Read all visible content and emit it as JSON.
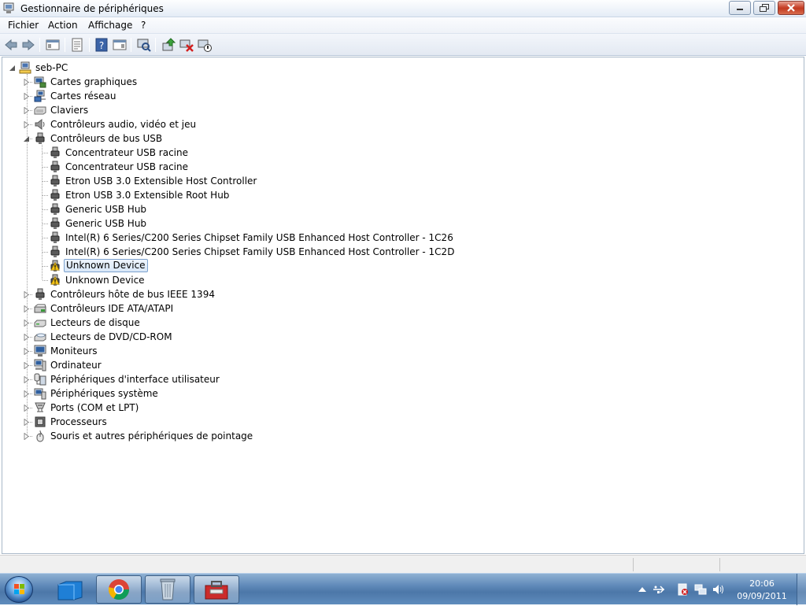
{
  "window": {
    "title": "Gestionnaire de périphériques"
  },
  "menu": {
    "items": [
      "Fichier",
      "Action",
      "Affichage",
      "?"
    ]
  },
  "toolbar": {
    "icons": [
      "back-arrow-icon",
      "forward-arrow-icon",
      "show-hide-console-tree-icon",
      "properties-icon",
      "help-icon",
      "show-action-pane-icon",
      "scan-hardware-icon",
      "update-driver-icon",
      "uninstall-icon",
      "disable-device-icon"
    ]
  },
  "tree": {
    "root": "seb-PC",
    "categories": [
      {
        "label": "Cartes graphiques",
        "icon": "display-adapter-icon",
        "expanded": false
      },
      {
        "label": "Cartes réseau",
        "icon": "network-adapter-icon",
        "expanded": false
      },
      {
        "label": "Claviers",
        "icon": "keyboard-icon",
        "expanded": false
      },
      {
        "label": "Contrôleurs audio, vidéo et jeu",
        "icon": "speaker-icon",
        "expanded": false
      },
      {
        "label": "Contrôleurs de bus USB",
        "icon": "usb-plug-icon",
        "expanded": true,
        "children": [
          {
            "label": "Concentrateur USB racine",
            "icon": "usb-plug-icon",
            "warning": false
          },
          {
            "label": "Concentrateur USB racine",
            "icon": "usb-plug-icon",
            "warning": false
          },
          {
            "label": "Etron USB 3.0 Extensible Host Controller",
            "icon": "usb-plug-icon",
            "warning": false
          },
          {
            "label": "Etron USB 3.0 Extensible Root Hub",
            "icon": "usb-plug-icon",
            "warning": false
          },
          {
            "label": "Generic USB Hub",
            "icon": "usb-plug-icon",
            "warning": false
          },
          {
            "label": "Generic USB Hub",
            "icon": "usb-plug-icon",
            "warning": false
          },
          {
            "label": "Intel(R) 6 Series/C200 Series Chipset Family USB Enhanced Host Controller - 1C26",
            "icon": "usb-plug-icon",
            "warning": false
          },
          {
            "label": "Intel(R) 6 Series/C200 Series Chipset Family USB Enhanced Host Controller - 1C2D",
            "icon": "usb-plug-icon",
            "warning": false
          },
          {
            "label": "Unknown Device",
            "icon": "usb-plug-icon",
            "warning": true,
            "selected": true
          },
          {
            "label": "Unknown Device",
            "icon": "usb-plug-icon",
            "warning": true
          }
        ]
      },
      {
        "label": "Contrôleurs hôte de bus IEEE 1394",
        "icon": "usb-plug-icon",
        "expanded": false
      },
      {
        "label": "Contrôleurs IDE ATA/ATAPI",
        "icon": "ide-controller-icon",
        "expanded": false
      },
      {
        "label": "Lecteurs de disque",
        "icon": "disk-drive-icon",
        "expanded": false
      },
      {
        "label": "Lecteurs de DVD/CD-ROM",
        "icon": "dvd-drive-icon",
        "expanded": false
      },
      {
        "label": "Moniteurs",
        "icon": "monitor-icon",
        "expanded": false
      },
      {
        "label": "Ordinateur",
        "icon": "computer-icon",
        "expanded": false
      },
      {
        "label": "Périphériques d'interface utilisateur",
        "icon": "hid-icon",
        "expanded": false
      },
      {
        "label": "Périphériques système",
        "icon": "system-device-icon",
        "expanded": false
      },
      {
        "label": "Ports (COM et LPT)",
        "icon": "port-icon",
        "expanded": false
      },
      {
        "label": "Processeurs",
        "icon": "processor-icon",
        "expanded": false
      },
      {
        "label": "Souris et autres périphériques de pointage",
        "icon": "mouse-icon",
        "expanded": false
      }
    ]
  },
  "taskbar": {
    "apps": [
      "desktop-folder-icon",
      "chrome-icon",
      "recycle-bin-icon",
      "device-manager-icon"
    ],
    "tray": [
      "show-hidden-icons-icon",
      "usb-safely-remove-icon",
      "action-center-icon",
      "network-icon",
      "volume-icon"
    ],
    "clock": {
      "time": "20:06",
      "date": "09/09/2011"
    }
  },
  "colors": {
    "warning": "#f5c518",
    "selection_border": "#7da2ce",
    "taskbar": "#5e88b8"
  }
}
